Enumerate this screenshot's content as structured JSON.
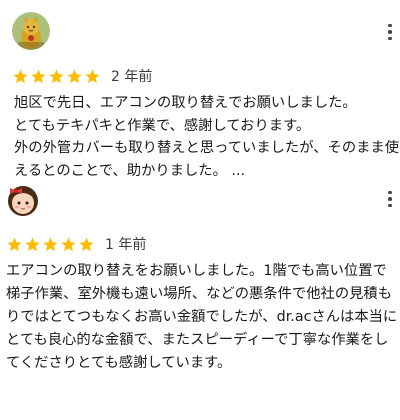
{
  "colors": {
    "star": "#fbbc04",
    "text": "#1a1a1a",
    "date": "#3c3c3c"
  },
  "reviews": [
    {
      "avatar_icon": "golden-cat-figurine-avatar",
      "more_icon": "more-vert-icon",
      "rating": 5,
      "date": "2 年前",
      "text": "旭区で先日、エアコンの取り替えでお願いしました。\nとてもテキパキと作業で、感謝しております。\n外の外管カバーも取り替えと思っていましたが、そのまま使えるとのことで、助かりました。 ..."
    },
    {
      "avatar_icon": "cartoon-girl-avatar",
      "more_icon": "more-vert-icon",
      "rating": 5,
      "date": "1 年前",
      "text": "エアコンの取り替えをお願いしました。1階でも高い位置で梯子作業、室外機も遠い場所、などの悪条件で他社の見積もりではとてつもなくお高い金額でしたが、dr.acさんは本当にとても良心的な金額で、またスピーディーで丁寧な作業をしてくださりとても感謝しています。"
    }
  ]
}
